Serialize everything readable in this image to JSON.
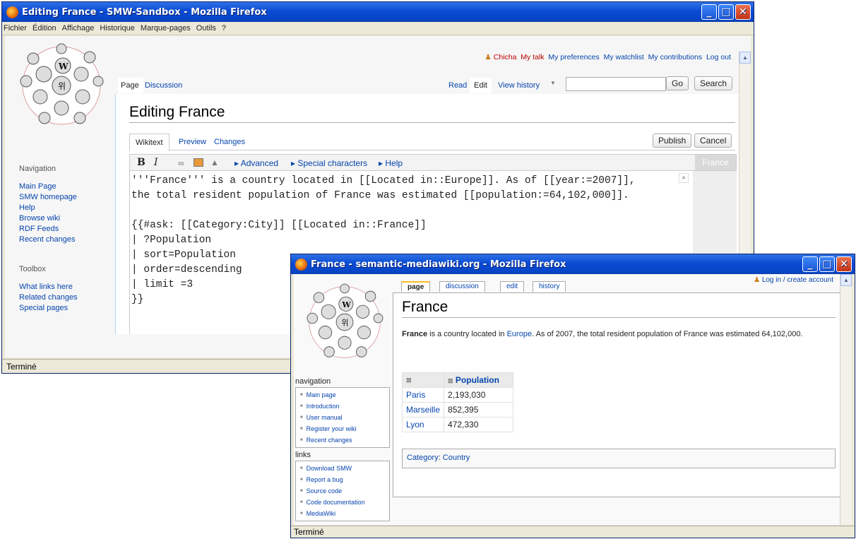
{
  "win1": {
    "title": "Editing France - SMW-Sandbox - Mozilla Firefox",
    "menu": [
      "Fichier",
      "Édition",
      "Affichage",
      "Historique",
      "Marque-pages",
      "Outils",
      "?"
    ],
    "user_links": [
      "Chicha",
      "My talk",
      "My preferences",
      "My watchlist",
      "My contributions",
      "Log out"
    ],
    "tabs_left": [
      "Page",
      "Discussion"
    ],
    "tabs_right": [
      "Read",
      "Edit",
      "View history"
    ],
    "go_label": "Go",
    "search_label": "Search",
    "heading": "Editing France",
    "edit_tabs": [
      "Wikitext",
      "Preview",
      "Changes"
    ],
    "publish_label": "Publish",
    "cancel_label": "Cancel",
    "toolbar": {
      "bold": "B",
      "italic": "I",
      "advanced": "Advanced",
      "special": "Special characters",
      "help": "Help",
      "badge": "France"
    },
    "wikitext": "'''France''' is a country located in [[Located in::Europe]]. As of [[year:=2007]],\nthe total resident population of France was estimated [[population:=64,102,000]].\n\n{{#ask: [[Category:City]] [[Located in::France]]\n| ?Population\n| sort=Population\n| order=descending\n| limit =3\n}}",
    "nav_heading": "Navigation",
    "nav": [
      "Main Page",
      "SMW homepage",
      "Help",
      "Browse wiki",
      "RDF Feeds",
      "Recent changes"
    ],
    "toolbox_heading": "Toolbox",
    "toolbox": [
      "What links here",
      "Related changes",
      "Special pages"
    ],
    "status": "Terminé"
  },
  "win2": {
    "title": "France - semantic-mediawiki.org - Mozilla Firefox",
    "login": "Log in / create account",
    "tabs": [
      "page",
      "discussion",
      "edit",
      "history"
    ],
    "heading": "France",
    "para_bold": "France",
    "para_1": " is a country located in ",
    "para_link": "Europe",
    "para_2": ". As of 2007, the total resident population of France was estimated 64,102,000.",
    "table_header": "Population",
    "rows": [
      [
        "Paris",
        "2,193,030"
      ],
      [
        "Marseille",
        "852,395"
      ],
      [
        "Lyon",
        "472,330"
      ]
    ],
    "category_label": "Category",
    "category_value": "Country",
    "nav_heading": "navigation",
    "nav": [
      "Main page",
      "Introduction",
      "User manual",
      "Register your wiki",
      "Recent changes"
    ],
    "links_heading": "links",
    "links": [
      "Download SMW",
      "Report a bug",
      "Source code",
      "Code documentation",
      "MediaWiki"
    ],
    "status": "Terminé"
  },
  "colors": {
    "link": "#0645ad",
    "titlebar": "#0a4bd3",
    "close": "#c43214"
  }
}
